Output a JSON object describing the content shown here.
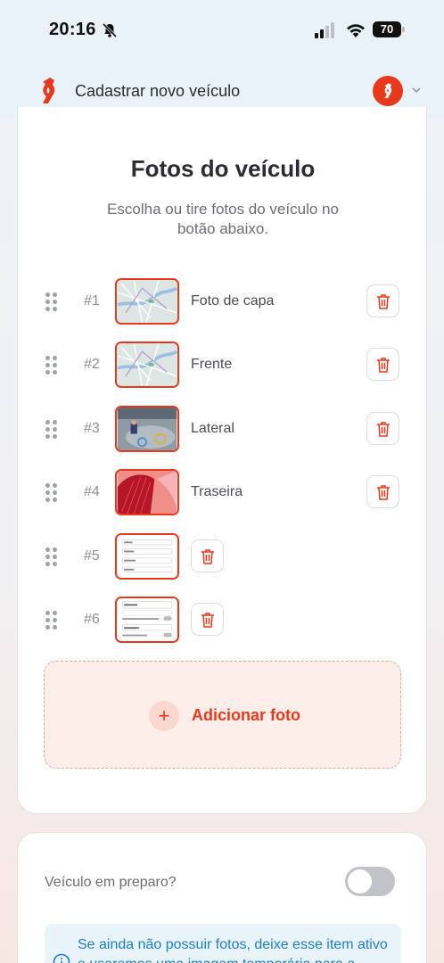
{
  "status_bar": {
    "time": "20:16",
    "battery": "70"
  },
  "header": {
    "title": "Cadastrar novo veículo"
  },
  "section": {
    "title": "Fotos do veículo",
    "subtitle": "Escolha ou tire fotos do veículo no botão abaixo."
  },
  "photos": [
    {
      "number": "#1",
      "label": "Foto de capa",
      "thumb": "map"
    },
    {
      "number": "#2",
      "label": "Frente",
      "thumb": "map"
    },
    {
      "number": "#3",
      "label": "Lateral",
      "thumb": "room"
    },
    {
      "number": "#4",
      "label": "Traseira",
      "thumb": "red-arch"
    },
    {
      "number": "#5",
      "label": "",
      "thumb": "form-screenshot"
    },
    {
      "number": "#6",
      "label": "",
      "thumb": "form-screenshot"
    }
  ],
  "add_photo": {
    "label": "Adicionar foto"
  },
  "prep": {
    "label": "Veículo em preparo?",
    "toggle_on": false,
    "info": "Se ainda não possuir fotos, deixe esse item ativo e usaremos uma imagem temporária para a"
  },
  "colors": {
    "accent": "#e8391d",
    "info": "#1f7fc4"
  }
}
